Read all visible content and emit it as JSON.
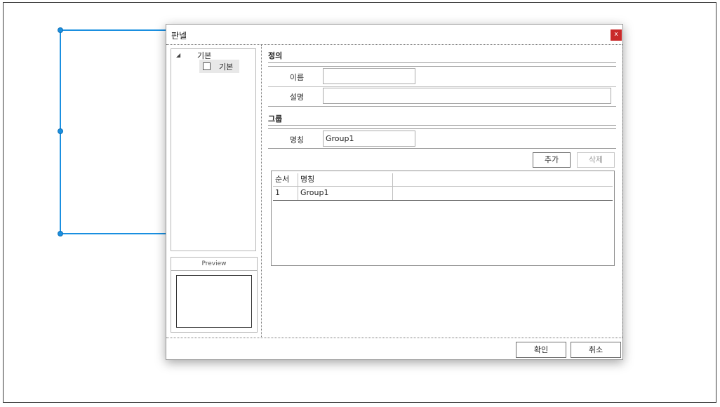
{
  "dialog": {
    "title": "판넬",
    "close_label": "x"
  },
  "tree": {
    "root_label": "기본",
    "child_label": "기본",
    "expand_glyph": "◢"
  },
  "preview": {
    "title": "Preview"
  },
  "definition": {
    "section_title": "정의",
    "name_label": "이름",
    "name_value": "",
    "description_label": "설명",
    "description_value": ""
  },
  "group": {
    "section_title": "그룹",
    "name_label": "명칭",
    "name_value": "Group1",
    "add_label": "추가",
    "delete_label": "삭제"
  },
  "grid": {
    "columns": [
      "순서",
      "명칭"
    ],
    "rows": [
      {
        "order": "1",
        "name": "Group1"
      }
    ]
  },
  "footer": {
    "ok_label": "확인",
    "cancel_label": "취소"
  },
  "colors": {
    "selection": "#1a8fe0",
    "close_button": "#c92a2a"
  }
}
